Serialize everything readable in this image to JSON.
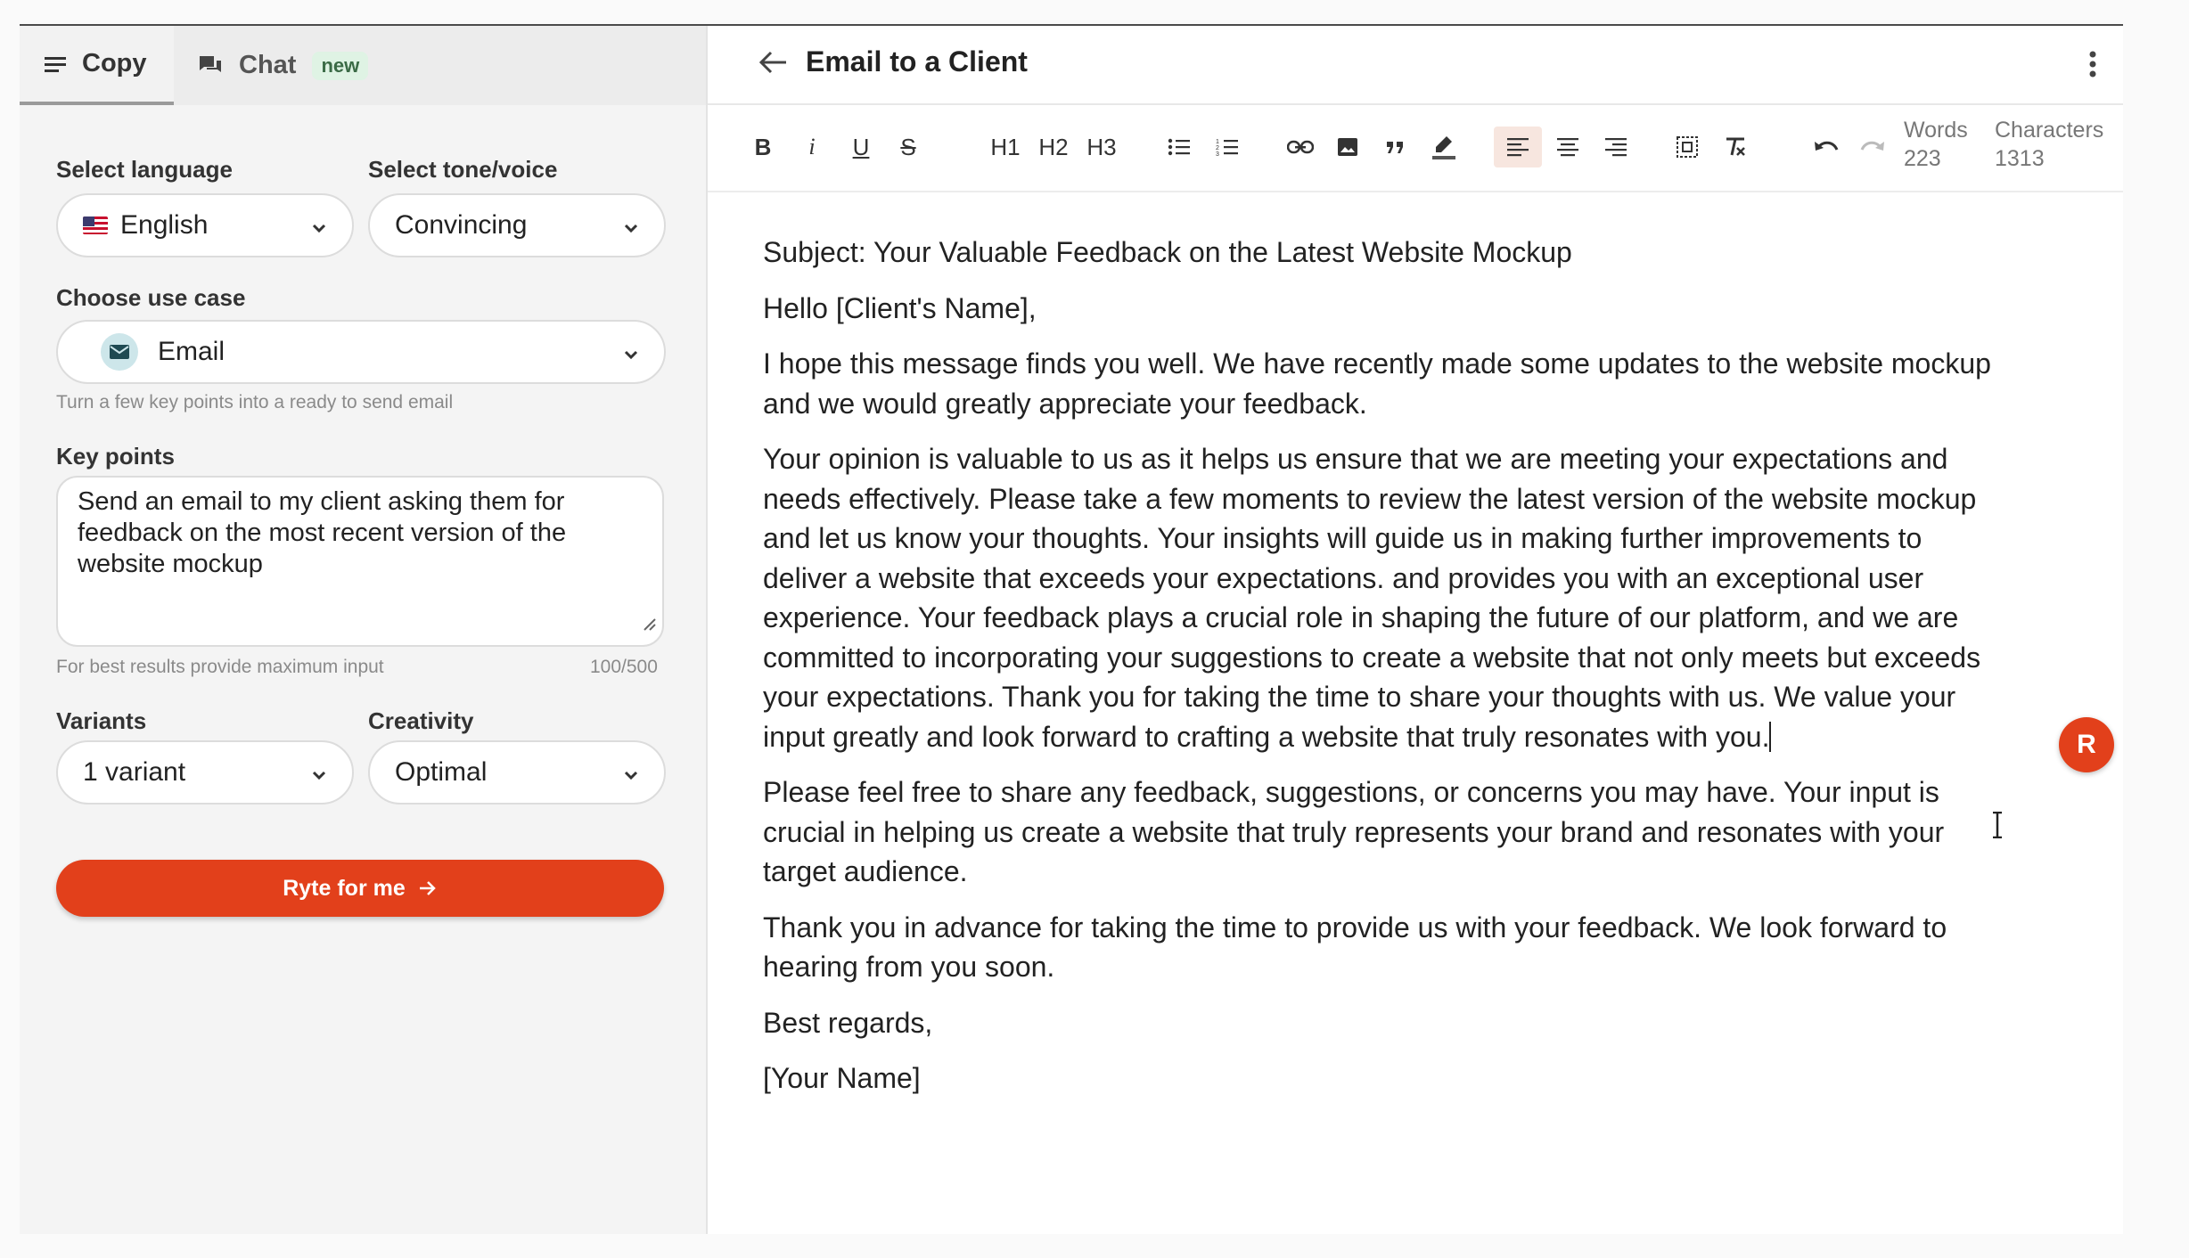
{
  "colors": {
    "accent": "#e2401b",
    "badge_bg": "#dff3e4",
    "active_button_bg": "#f7e6df"
  },
  "left": {
    "tabs": [
      {
        "label": "Copy",
        "icon": "menu-lines-icon",
        "active": true
      },
      {
        "label": "Chat",
        "icon": "chat-icon",
        "badge": "new",
        "active": false
      }
    ],
    "language": {
      "label": "Select language",
      "value": "English",
      "icon": "us-flag-icon"
    },
    "tone": {
      "label": "Select tone/voice",
      "value": "Convincing"
    },
    "use_case": {
      "label": "Choose use case",
      "value": "Email",
      "icon": "envelope-icon",
      "hint": "Turn a few key points into a ready to send email"
    },
    "key_points": {
      "label": "Key points",
      "value": "Send an email to my client asking them for feedback on the most recent version of the website mockup",
      "hint": "For best results provide maximum input",
      "counter": "100/500"
    },
    "variants": {
      "label": "Variants",
      "value": "1 variant"
    },
    "creativity": {
      "label": "Creativity",
      "value": "Optimal"
    },
    "cta": {
      "label": "Ryte for me"
    }
  },
  "document": {
    "title": "Email to a Client",
    "toolbar": {
      "heading_labels": [
        "H1",
        "H2",
        "H3"
      ],
      "words_label": "Words",
      "words_value": "223",
      "chars_label": "Characters",
      "chars_value": "1313",
      "active_alignment": "left"
    },
    "paragraphs": [
      "Subject: Your Valuable Feedback on the Latest Website Mockup",
      "Hello [Client's Name],",
      "I hope this message finds you well. We have recently made some updates to the website mockup and we would greatly appreciate your feedback.",
      "Your opinion is valuable to us as it helps us ensure that we are meeting your expectations and needs effectively. Please take a few moments to review the latest version of the website mockup and let us know your thoughts. Your insights will guide us in making further improvements to deliver a website that exceeds your expectations. and provides you with an exceptional user experience. Your feedback plays a crucial role in shaping the future of our platform, and we are committed to incorporating your suggestions to create a website that not only meets but exceeds your expectations. Thank you for taking the time to share your thoughts with us. We value your input greatly and look forward to crafting a website that truly resonates with you.",
      "Please feel free to share any feedback, suggestions, or concerns you may have. Your input is crucial in helping us create a website that truly represents your brand and resonates with your target audience.",
      "Thank you in advance for taking the time to provide us with your feedback. We look forward to hearing from you soon.",
      "Best regards,",
      "[Your Name]"
    ],
    "fab_label": "R"
  }
}
